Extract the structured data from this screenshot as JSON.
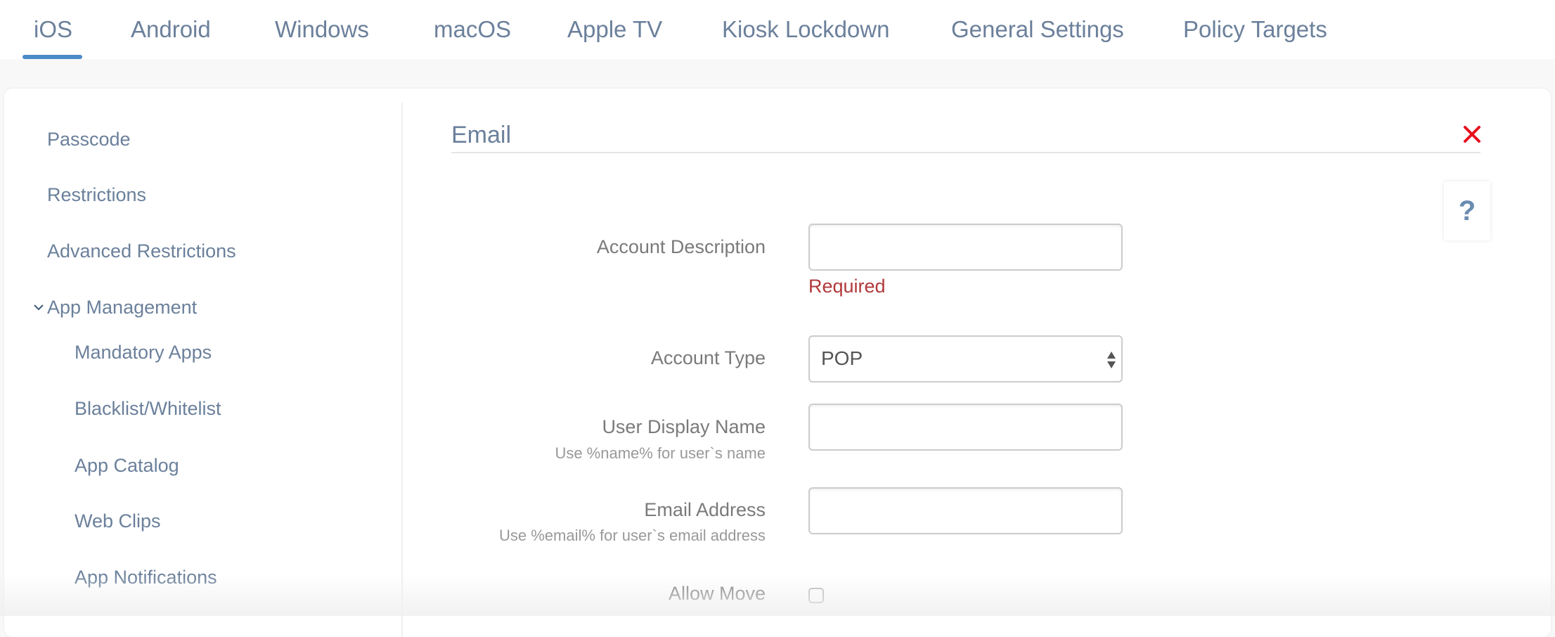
{
  "tabs": [
    {
      "label": "iOS",
      "active": true
    },
    {
      "label": "Android",
      "active": false
    },
    {
      "label": "Windows",
      "active": false
    },
    {
      "label": "macOS",
      "active": false
    },
    {
      "label": "Apple TV",
      "active": false
    },
    {
      "label": "Kiosk Lockdown",
      "active": false
    },
    {
      "label": "General Settings",
      "active": false
    },
    {
      "label": "Policy Targets",
      "active": false
    }
  ],
  "sidebar": {
    "items": [
      {
        "label": "Passcode"
      },
      {
        "label": "Restrictions"
      },
      {
        "label": "Advanced Restrictions"
      },
      {
        "label": "App Management",
        "expanded": true,
        "icon": "chevron-down-icon"
      },
      {
        "label": "Mandatory Apps"
      },
      {
        "label": "Blacklist/Whitelist"
      },
      {
        "label": "App Catalog"
      },
      {
        "label": "Web Clips"
      },
      {
        "label": "App Notifications"
      }
    ]
  },
  "section": {
    "title": "Email",
    "close_icon": "close-icon",
    "help_label": "?"
  },
  "form": {
    "account_description": {
      "label": "Account Description",
      "value": "",
      "validation": "Required"
    },
    "account_type": {
      "label": "Account Type",
      "value": "POP"
    },
    "user_display_name": {
      "label": "User Display Name",
      "hint": "Use %name% for user`s name",
      "value": ""
    },
    "email_address": {
      "label": "Email Address",
      "hint": "Use %email% for user`s email address",
      "value": ""
    },
    "allow_move": {
      "label": "Allow Move",
      "checked": false
    }
  },
  "colors": {
    "accent": "#4a8ac8",
    "nav_text": "#6b809b",
    "error": "#b0393b",
    "close": "#e8101e"
  }
}
